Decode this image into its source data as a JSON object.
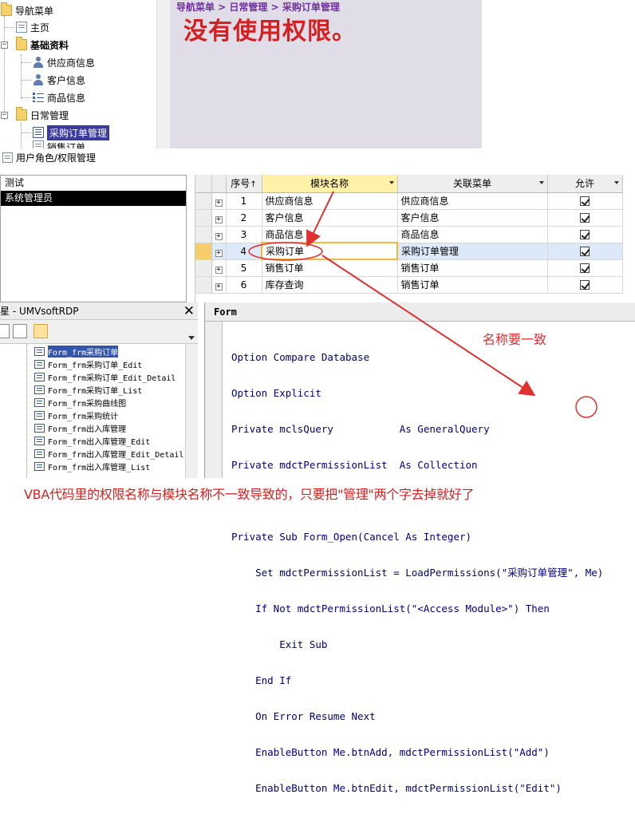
{
  "nav_tree": {
    "root_label": "导航菜单",
    "items": [
      {
        "label": "主页"
      },
      {
        "label": "基础资料",
        "children": [
          "供应商信息",
          "客户信息",
          "商品信息"
        ]
      },
      {
        "label": "日常管理",
        "children": [
          "采购订单管理",
          "销售订单"
        ]
      }
    ],
    "role_permission_label": "用户角色/权限管理"
  },
  "header": {
    "breadcrumb": "导航菜单 > 日常管理 > 采购订单管理",
    "message": "没有使用权限。"
  },
  "roles": [
    "测试",
    "系统管理员"
  ],
  "grid": {
    "columns": {
      "seq": "序号",
      "module": "模块名称",
      "menu": "关联菜单",
      "allow": "允许"
    },
    "sort_mark": "↑",
    "rows": [
      {
        "seq": "1",
        "module": "供应商信息",
        "menu": "供应商信息",
        "allow": true
      },
      {
        "seq": "2",
        "module": "客户信息",
        "menu": "客户信息",
        "allow": true
      },
      {
        "seq": "3",
        "module": "商品信息",
        "menu": "商品信息",
        "allow": true
      },
      {
        "seq": "4",
        "module": "采购订单",
        "menu": "采购订单管理",
        "allow": true
      },
      {
        "seq": "5",
        "module": "销售订单",
        "menu": "销售订单",
        "allow": true
      },
      {
        "seq": "6",
        "module": "库存查询",
        "menu": "销售订单",
        "allow": true
      }
    ]
  },
  "project": {
    "title": "星 - UMVsoftRDP",
    "forms": [
      "Form_frm采购订单",
      "Form_frm采购订单_Edit",
      "Form_frm采购订单_Edit_Detail",
      "Form_frm采购订单_List",
      "Form_frm采购曲线图",
      "Form_frm采购统计",
      "Form_frm出入库管理",
      "Form_frm出入库管理_Edit",
      "Form_frm出入库管理_Edit_Detail",
      "Form_frm出入库管理_List"
    ]
  },
  "code": {
    "object": "Form",
    "lines": [
      "Option Compare Database",
      "Option Explicit",
      "Private mclsQuery           As GeneralQuery",
      "Private mdctPermissionList  As Collection",
      "",
      "Private Sub Form_Open(Cancel As Integer)",
      "    Set mdctPermissionList = LoadPermissions(\"采购订单管理\", Me)",
      "    If Not mdctPermissionList(\"<Access Module>\") Then",
      "        Exit Sub",
      "    End If",
      "    On Error Resume Next",
      "    EnableButton Me.btnAdd, mdctPermissionList(\"Add\")",
      "    EnableButton Me.btnEdit, mdctPermissionList(\"Edit\")"
    ]
  },
  "annotations": {
    "name_consistent": "名称要一致",
    "caption": "VBA代码里的权限名称与模块名称不一致导致的，只要把\"管理\"两个字去掉就好了"
  },
  "colors": {
    "breadcrumb": "#7030a0",
    "message": "#d42020",
    "annotation": "#e03030",
    "header_bg": "#e0dce8"
  }
}
